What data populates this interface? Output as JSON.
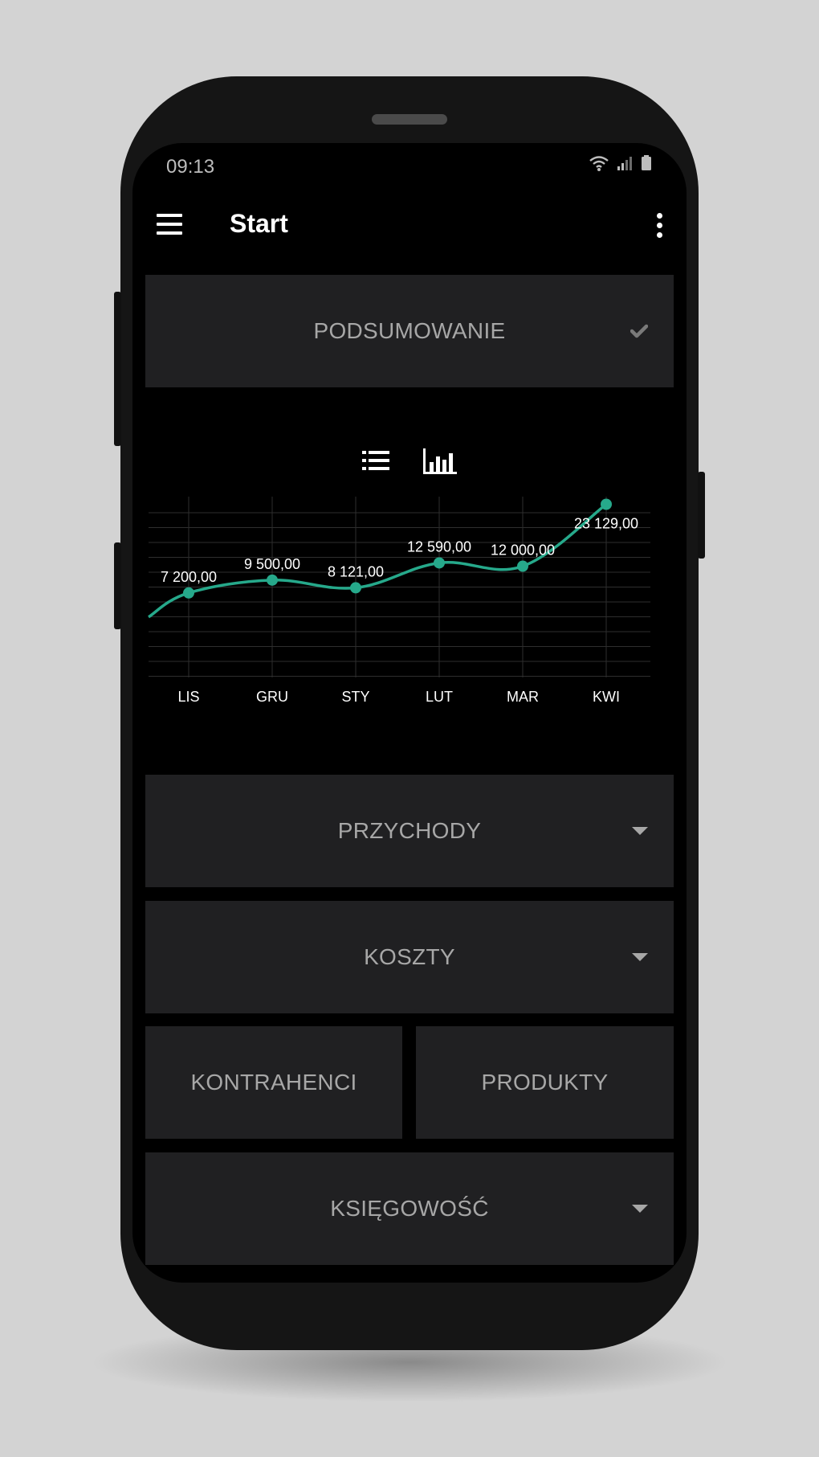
{
  "status_bar": {
    "time": "09:13"
  },
  "app_bar": {
    "title": "Start"
  },
  "summary": {
    "label": "PODSUMOWANIE"
  },
  "sections": {
    "income": "PRZYCHODY",
    "costs": "KOSZTY",
    "contractors": "KONTRAHENCI",
    "products": "PRODUKTY",
    "accounting": "KSIĘGOWOŚĆ"
  },
  "icons": {
    "menu": "menu-icon",
    "more": "more-vert-icon",
    "summary_check": "check-icon",
    "list_view": "list-icon",
    "chart_view": "bar-chart-icon",
    "dropdown": "caret-down-icon"
  },
  "colors": {
    "accent": "#26a98b",
    "card": "#202022",
    "screen": "#000000",
    "text_muted": "#a7a7a7"
  },
  "chart_data": {
    "type": "line",
    "categories": [
      "LIS",
      "GRU",
      "STY",
      "LUT",
      "MAR",
      "KWI"
    ],
    "values": [
      7200,
      9500,
      8121,
      12590,
      12000,
      23129
    ],
    "value_labels": [
      "7 200,00",
      "9 500,00",
      "8 121,00",
      "12 590,00",
      "12 000,00",
      "23 129,00"
    ],
    "smooth": true,
    "grid": true,
    "color": "#26a98b",
    "ylim": [
      -8000,
      24500
    ]
  }
}
